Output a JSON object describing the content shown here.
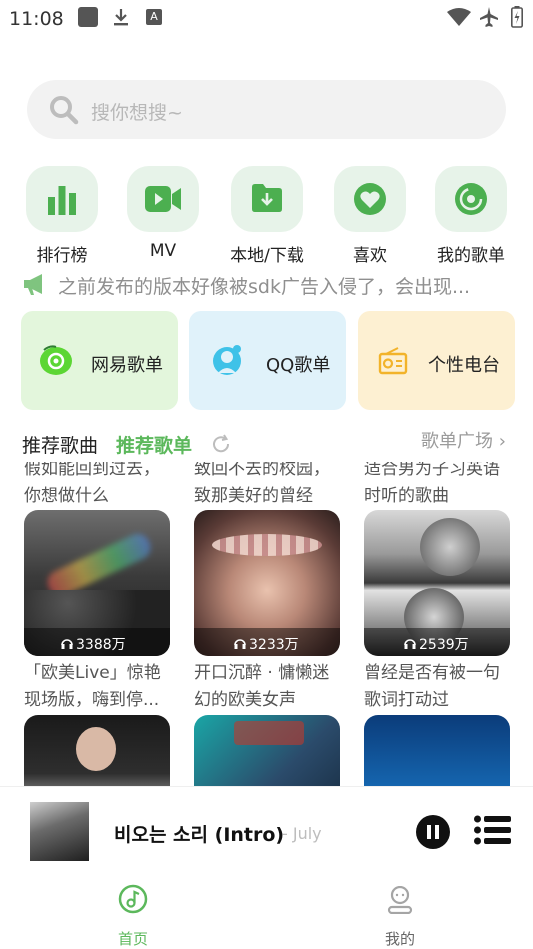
{
  "status_bar": {
    "time": "11:08"
  },
  "search": {
    "placeholder": "搜你想搜~"
  },
  "quick_entries": [
    {
      "label": "排行榜",
      "icon": "bar-chart-icon"
    },
    {
      "label": "MV",
      "icon": "video-camera-icon"
    },
    {
      "label": "本地/下载",
      "icon": "folder-download-icon"
    },
    {
      "label": "喜欢",
      "icon": "heart-icon"
    },
    {
      "label": "我的歌单",
      "icon": "music-disc-icon"
    }
  ],
  "notice": {
    "text": "之前发布的版本好像被sdk广告入侵了，会出现..."
  },
  "feature_cards": [
    {
      "label": "网易歌单",
      "bg": "#e3f6dc"
    },
    {
      "label": "QQ歌单",
      "bg": "#e0f2fa"
    },
    {
      "label": "个性电台",
      "bg": "#fdf0d2"
    }
  ],
  "section": {
    "tab_songs": "推荐歌曲",
    "tab_playlists": "推荐歌单",
    "more": "歌单广场"
  },
  "playlists_top_partial": [
    {
      "line1": "假如能回到过去，",
      "line2": "你想做什么"
    },
    {
      "line1": "致回不去的校园，",
      "line2": "致那美好的曾经"
    },
    {
      "line1": "适合男为子习英语",
      "line2": "时听的歌曲"
    }
  ],
  "playlists": [
    {
      "count": "3388万",
      "title_line1": "「欧美Live」惊艳",
      "title_line2": "现场版，嗨到停..."
    },
    {
      "count": "3233万",
      "title_line1": "开口沉醉 · 慵懒迷",
      "title_line2": "幻的欧美女声"
    },
    {
      "count": "2539万",
      "title_line1": "曾经是否有被一句",
      "title_line2": "歌词打动过"
    }
  ],
  "player": {
    "song": "비오는 소리 (Intro)",
    "artist": "- July"
  },
  "bottom_nav": [
    {
      "label": "首页",
      "active": true
    },
    {
      "label": "我的",
      "active": false
    }
  ],
  "colors": {
    "accent": "#5cb85c",
    "icon_green": "#4caf50"
  }
}
